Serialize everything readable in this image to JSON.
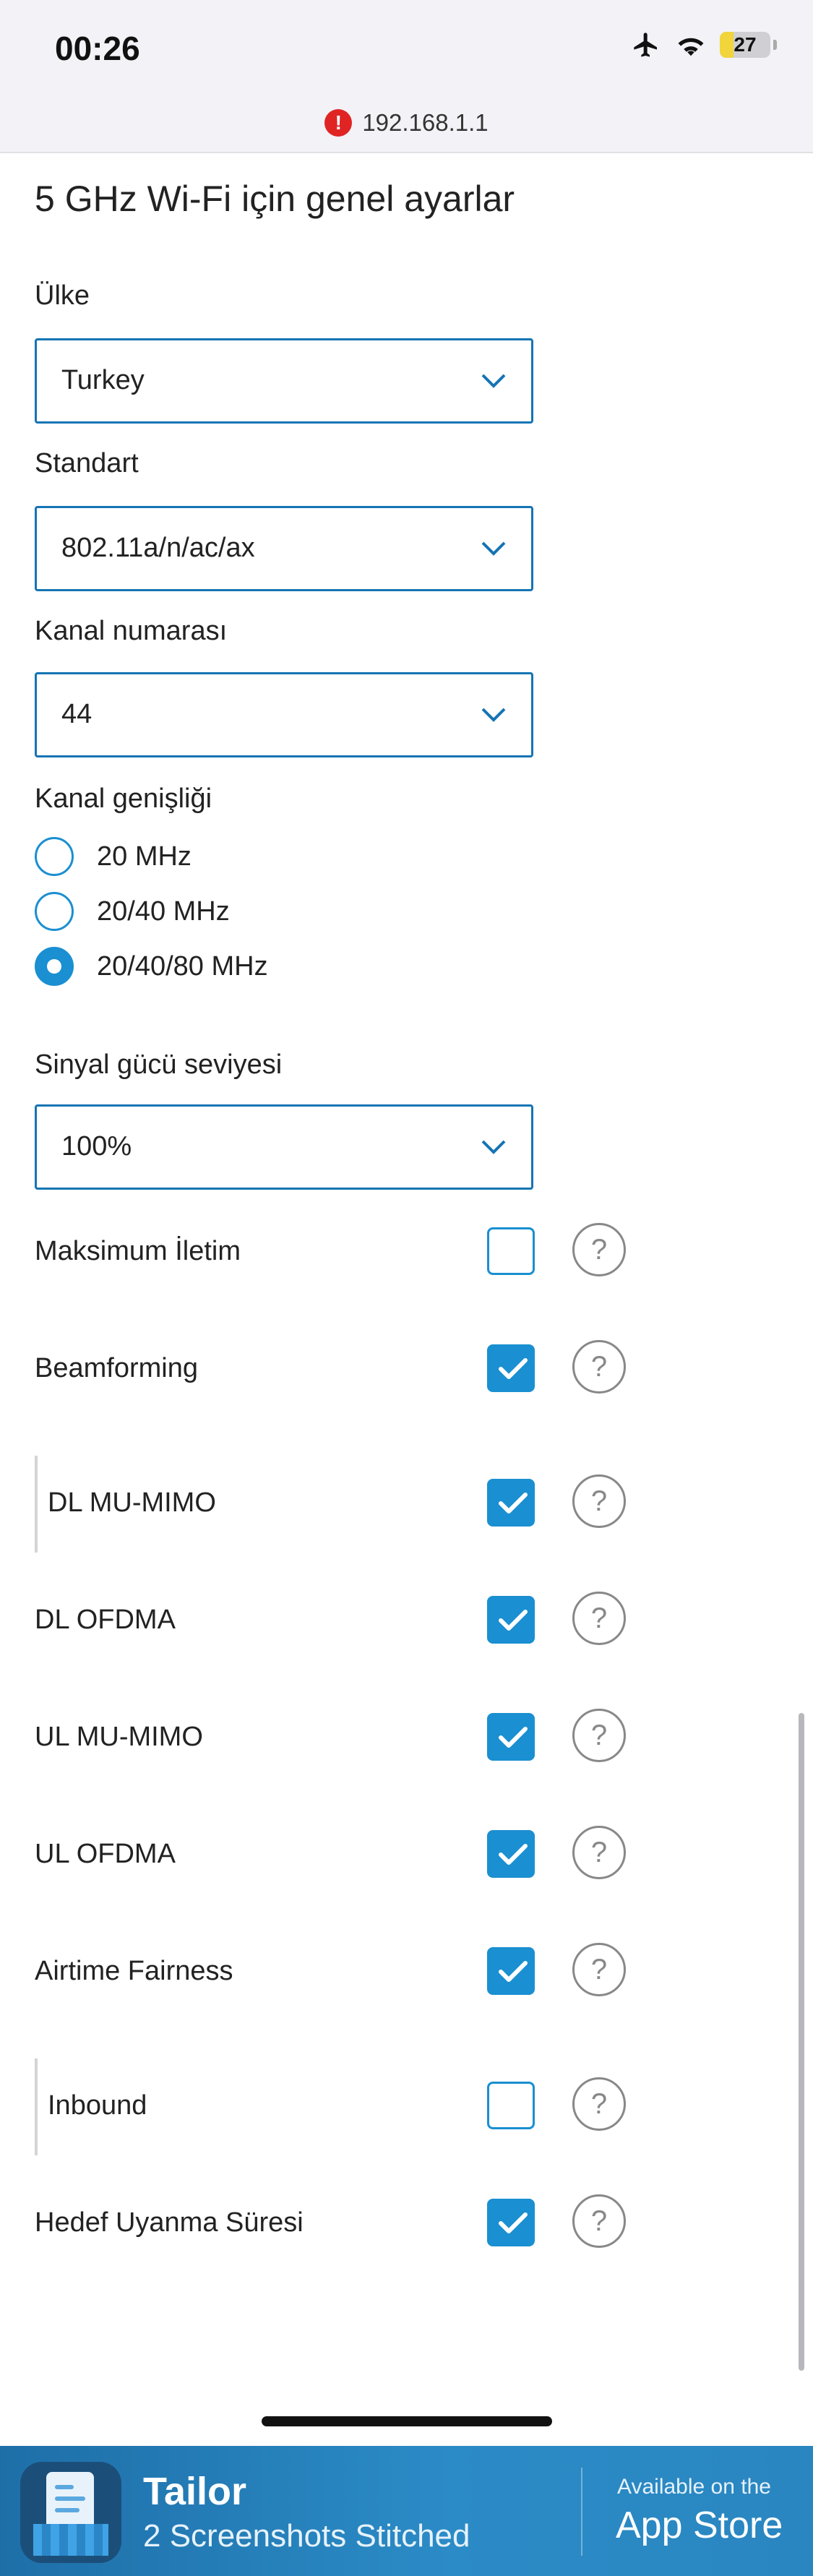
{
  "status_bar": {
    "time": "00:26",
    "battery": "27",
    "battery_level": 0.27
  },
  "url_bar": {
    "url": "192.168.1.1"
  },
  "page": {
    "title": "5 GHz Wi-Fi için genel ayarlar"
  },
  "country": {
    "label": "Ülke",
    "value": "Turkey"
  },
  "standard": {
    "label": "Standart",
    "value": "802.11a/n/ac/ax"
  },
  "channel": {
    "label": "Kanal numarası",
    "value": "44"
  },
  "channel_width": {
    "label": "Kanal genişliği",
    "options": [
      {
        "label": "20 MHz",
        "selected": false
      },
      {
        "label": "20/40 MHz",
        "selected": false
      },
      {
        "label": "20/40/80 MHz",
        "selected": true
      }
    ]
  },
  "signal_power": {
    "label": "Sinyal gücü seviyesi",
    "value": "100%"
  },
  "options": [
    {
      "label": "Maksimum İletim",
      "checked": false,
      "indented": false
    },
    {
      "label": "Beamforming",
      "checked": true,
      "indented": false
    },
    {
      "label": "DL MU-MIMO",
      "checked": true,
      "indented": true
    },
    {
      "label": "DL OFDMA",
      "checked": true,
      "indented": false
    },
    {
      "label": "UL MU-MIMO",
      "checked": true,
      "indented": false
    },
    {
      "label": "UL OFDMA",
      "checked": true,
      "indented": false
    },
    {
      "label": "Airtime Fairness",
      "checked": true,
      "indented": false
    },
    {
      "label": "Inbound",
      "checked": false,
      "indented": true
    },
    {
      "label": "Hedef Uyanma Süresi",
      "checked": true,
      "indented": false
    }
  ],
  "help_glyph": "?",
  "banner": {
    "app_name": "Tailor",
    "subtitle": "2 Screenshots Stitched",
    "available": "Available on the",
    "store": "App Store"
  },
  "colors": {
    "accent": "#1a8fd1",
    "select_border": "#1574b4",
    "warning": "#e02424"
  }
}
